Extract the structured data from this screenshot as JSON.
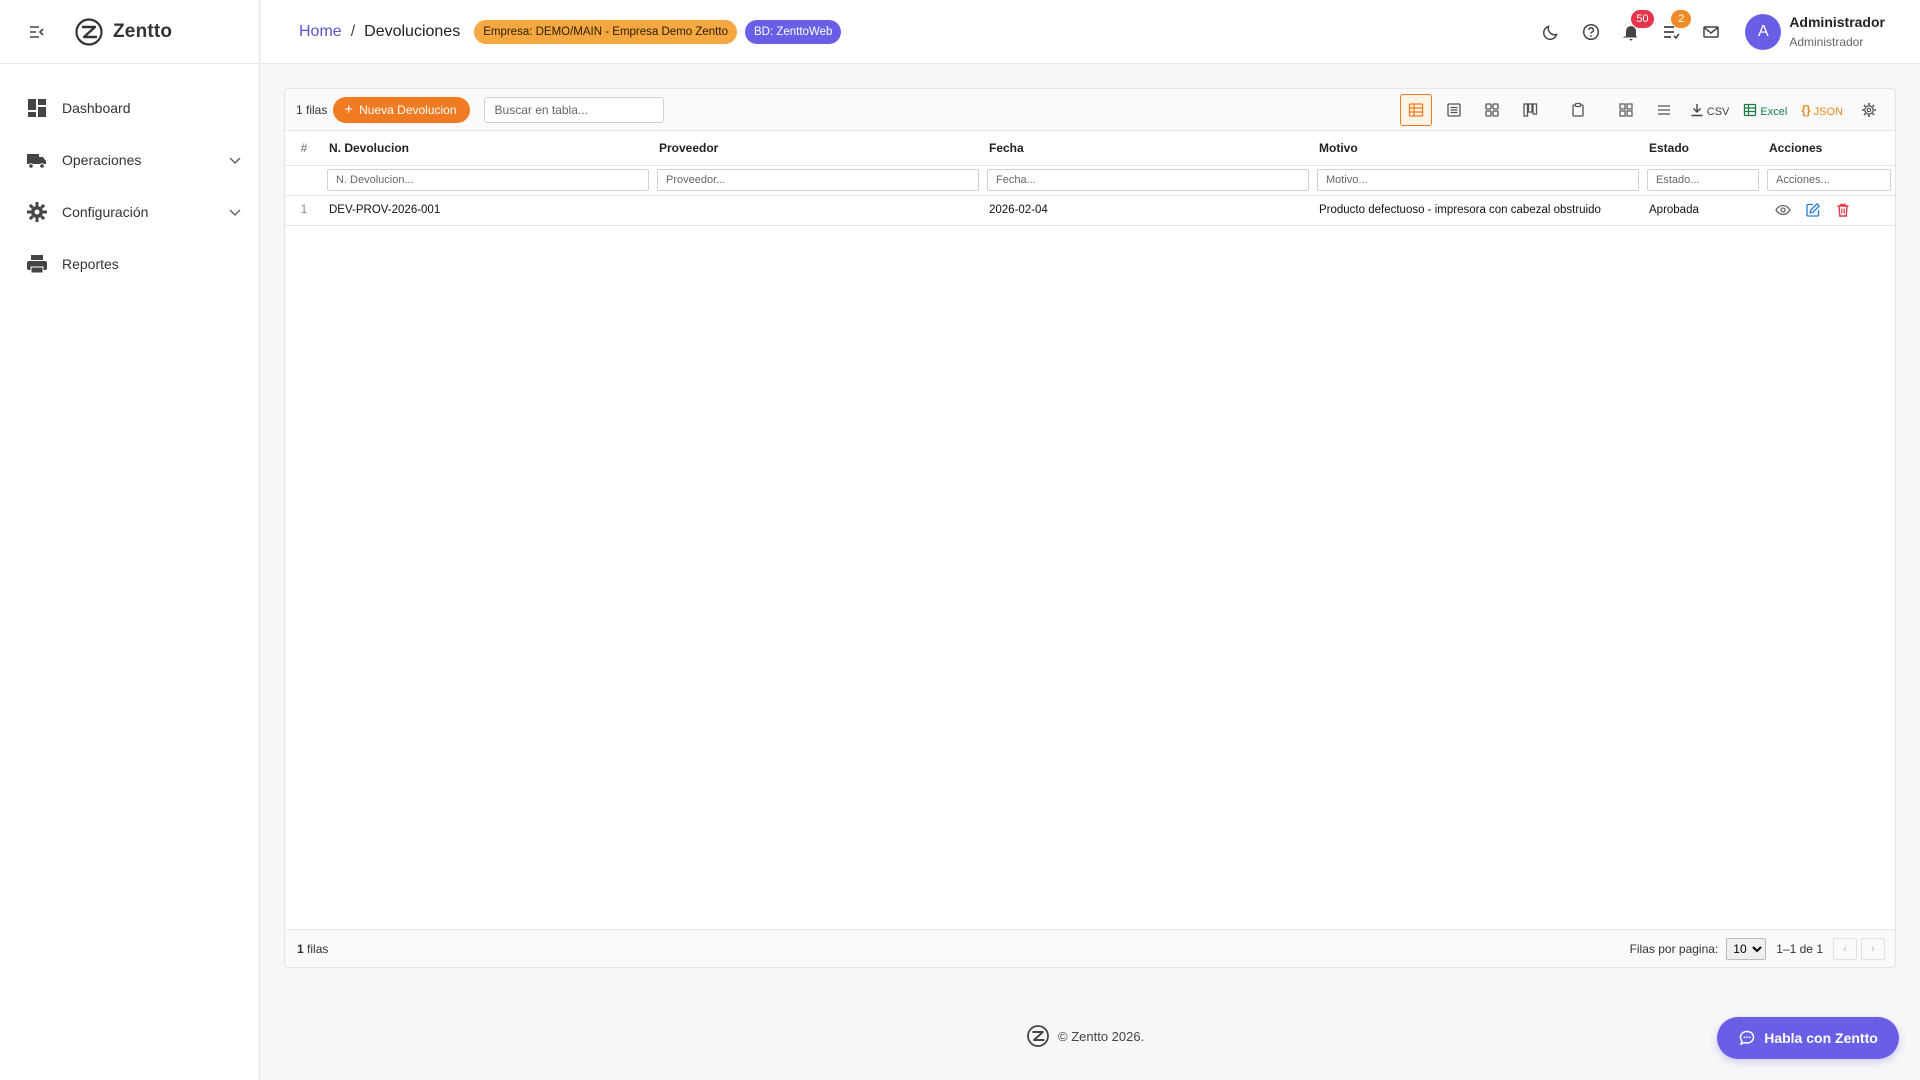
{
  "app": {
    "name": "Zentto",
    "footer_text": "© Zentto 2026."
  },
  "sidebar": {
    "items": [
      {
        "label": "Dashboard",
        "icon": "dashboard-icon"
      },
      {
        "label": "Operaciones",
        "icon": "truck-icon",
        "expandable": true
      },
      {
        "label": "Configuración",
        "icon": "gear-icon",
        "expandable": true
      },
      {
        "label": "Reportes",
        "icon": "printer-icon"
      }
    ]
  },
  "header": {
    "breadcrumb_home": "Home",
    "breadcrumb_separator": "/",
    "breadcrumb_current": "Devoluciones",
    "company_chip": "Empresa: DEMO/MAIN - Empresa Demo Zentto",
    "db_chip": "BD: ZenttoWeb",
    "notifications_count": "50",
    "tasks_count": "2",
    "user_initial": "A",
    "user_name": "Administrador",
    "user_role": "Administrador"
  },
  "toolbar": {
    "row_count": "1 filas",
    "new_button": "Nueva Devolucion",
    "search_placeholder": "Buscar en tabla...",
    "csv_label": "CSV",
    "excel_label": "Excel",
    "json_label": "JSON"
  },
  "table": {
    "columns": [
      "#",
      "N. Devolucion",
      "Proveedor",
      "Fecha",
      "Motivo",
      "Estado",
      "Acciones"
    ],
    "filter_placeholders": [
      "N. Devolucion...",
      "Proveedor...",
      "Fecha...",
      "Motivo...",
      "Estado...",
      "Acciones..."
    ],
    "rows": [
      {
        "index": "1",
        "numero": "DEV-PROV-2026-001",
        "proveedor": "",
        "fecha": "2026-02-04",
        "motivo": "Producto defectuoso - impresora con cabezal obstruido",
        "estado": "Aprobada"
      }
    ]
  },
  "grid_footer": {
    "count_number": "1",
    "count_label": "filas",
    "rows_per_page_label": "Filas por pagina:",
    "rows_per_page_value": "10",
    "range": "1–1 de 1"
  },
  "chat": {
    "label": "Habla con Zentto"
  },
  "colors": {
    "primary": "#6b5ee6",
    "accent": "#f07b22",
    "company_chip": "#f5a742",
    "danger": "#e8344a"
  }
}
